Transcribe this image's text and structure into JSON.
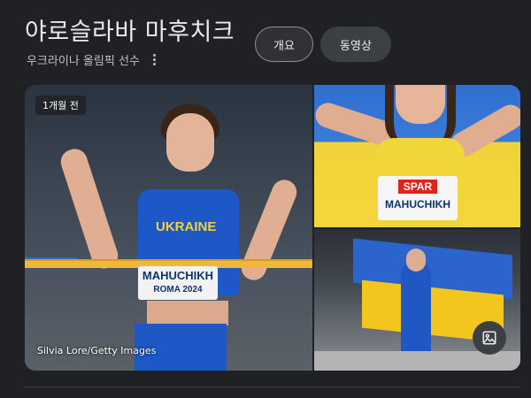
{
  "header": {
    "title": "야로슬라바 마후치크",
    "subtitle": "우크라이나 올림픽 선수"
  },
  "chips": {
    "overview": "개요",
    "video": "동영상"
  },
  "images": {
    "main": {
      "age_badge": "1개월 전",
      "credit": "Silvia Lore/Getty Images",
      "bib_line1": "MAHUCHIKH",
      "bib_line2": "ROMA 2024",
      "jersey_text": "UKRAINE"
    },
    "top_right": {
      "sponsor": "SPAR",
      "bib_name": "MAHUCHIKH"
    }
  },
  "colors": {
    "background": "#202124",
    "text": "#e8eaed",
    "secondary_text": "#bdc1c6",
    "chip_bg": "#303134"
  },
  "icons": {
    "more": "more-vert-icon",
    "gallery": "image-gallery-icon"
  }
}
